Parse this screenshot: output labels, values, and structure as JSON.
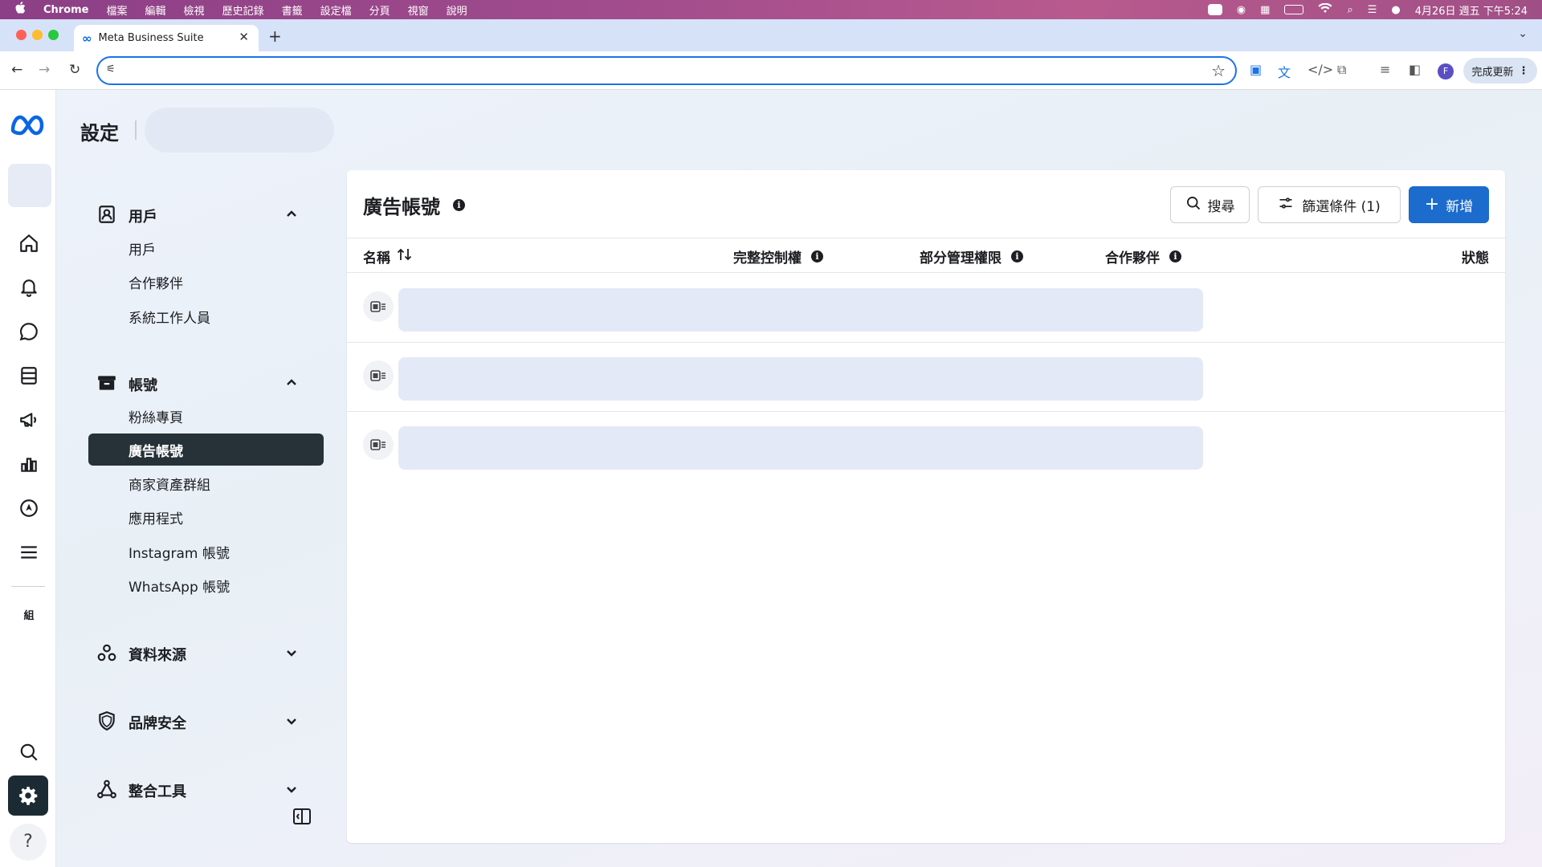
{
  "menubar": {
    "app": "Chrome",
    "items": [
      "檔案",
      "編輯",
      "檢視",
      "歷史記錄",
      "書籤",
      "設定檔",
      "分頁",
      "視窗",
      "說明"
    ],
    "clock": "4月26日 週五 下午5:24"
  },
  "browser": {
    "tab_title": "Meta Business Suite",
    "url": "",
    "profile_initial": "F",
    "update_label": "完成更新"
  },
  "page": {
    "title": "設定",
    "sidebar": {
      "sections": [
        {
          "label": "用戶",
          "icon": "users-icon",
          "expanded": true,
          "items": [
            "用戶",
            "合作夥伴",
            "系統工作人員"
          ]
        },
        {
          "label": "帳號",
          "icon": "accounts-icon",
          "expanded": true,
          "items": [
            "粉絲專頁",
            "廣告帳號",
            "商家資產群組",
            "應用程式",
            "Instagram 帳號",
            "WhatsApp 帳號"
          ],
          "active": "廣告帳號"
        },
        {
          "label": "資料來源",
          "icon": "data-sources-icon",
          "expanded": false
        },
        {
          "label": "品牌安全",
          "icon": "shield-icon",
          "expanded": false
        },
        {
          "label": "整合工具",
          "icon": "integrations-icon",
          "expanded": false
        }
      ]
    },
    "panel": {
      "title": "廣告帳號",
      "search_label": "搜尋",
      "filter_label": "篩選條件 (1)",
      "add_label": "新增",
      "columns": [
        "名稱",
        "完整控制權",
        "部分管理權限",
        "合作夥伴",
        "狀態"
      ],
      "row_count": 3
    },
    "rail_badge": "組"
  },
  "colors": {
    "primary": "#1b6ccd",
    "active_nav": "#263238",
    "skeleton": "#e3e9f6"
  }
}
